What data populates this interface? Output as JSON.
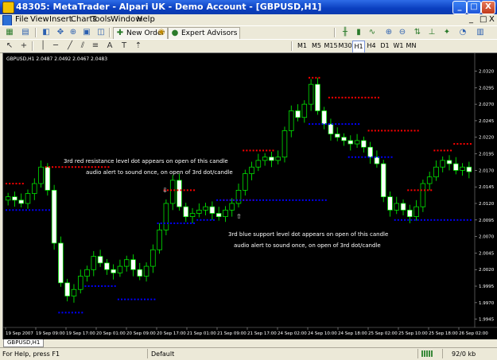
{
  "window": {
    "title": "48305: MetaTrader - Alpari UK - Demo Account - [GBPUSD,H1]",
    "min_label": "_",
    "max_label": "□",
    "close_label": "X"
  },
  "menu": [
    "File",
    "View",
    "Insert",
    "Charts",
    "Tools",
    "Window",
    "Help"
  ],
  "mdi_controls": [
    "_",
    "□",
    "X"
  ],
  "toolbar": {
    "new_order_label": "New Order",
    "expert_advisors_label": "Expert Advisors"
  },
  "timeframes": [
    "M1",
    "M5",
    "M15",
    "M30",
    "H1",
    "H4",
    "D1",
    "W1",
    "MN"
  ],
  "active_timeframe": "H1",
  "chart": {
    "header": "GBPUSD,H1  2.0487 2.0492 2.0467 2.0483",
    "annotations": {
      "red_line1": "3rd red resistance level dot appears on open of this candle",
      "red_line2": "audio alert to sound once, on open of 3rd dot/candle",
      "blue_line1": "3rd blue support level dot appears on open of this candle",
      "blue_line2": "audio alert to sound once, on open of 3rd dot/candle"
    },
    "colors": {
      "background": "#000000",
      "candle_outline": "#00FF00",
      "resistance_dots": "#FF0000",
      "support_dots": "#0000FF",
      "axis_text": "#FFFFFF"
    }
  },
  "chart_data": {
    "type": "candlestick",
    "symbol": "GBPUSD",
    "timeframe": "H1",
    "ylim": [
      1.9935,
      2.0335
    ],
    "y_ticks": [
      "2.0320",
      "2.0295",
      "2.0270",
      "2.0245",
      "2.0220",
      "2.0195",
      "2.0170",
      "2.0145",
      "2.0120",
      "2.0095",
      "2.0070",
      "2.0045",
      "2.0020",
      "1.9995",
      "1.9970",
      "1.9945"
    ],
    "x_ticks": [
      "19 Sep 2007",
      "19 Sep 09:00",
      "19 Sep 17:00",
      "20 Sep 01:00",
      "20 Sep 09:00",
      "20 Sep 17:00",
      "21 Sep 01:00",
      "21 Sep 09:00",
      "21 Sep 17:00",
      "24 Sep 02:00",
      "24 Sep 10:00",
      "24 Sep 18:00",
      "25 Sep 02:00",
      "25 Sep 10:00",
      "25 Sep 18:00",
      "26 Sep 02:00"
    ],
    "close_series": [
      2.013,
      2.0125,
      2.012,
      2.0135,
      2.015,
      2.0175,
      2.014,
      2.006,
      2.0,
      1.998,
      1.999,
      2.001,
      2.002,
      2.004,
      2.003,
      2.002,
      2.0015,
      2.0025,
      2.0035,
      2.002,
      2.001,
      2.0025,
      2.005,
      2.008,
      2.012,
      2.0155,
      2.0115,
      2.01,
      2.0105,
      2.011,
      2.0115,
      2.0105,
      2.01,
      2.011,
      2.012,
      2.014,
      2.0165,
      2.0175,
      2.0185,
      2.019,
      2.0185,
      2.019,
      2.023,
      2.026,
      2.025,
      2.027,
      2.03,
      2.026,
      2.024,
      2.0225,
      2.022,
      2.0215,
      2.021,
      2.0215,
      2.0205,
      2.019,
      2.018,
      2.013,
      2.011,
      2.012,
      2.011,
      2.01,
      2.0115,
      2.015,
      2.016,
      2.0175,
      2.0185,
      2.018,
      2.017,
      2.0175,
      2.0168
    ],
    "resistance_levels": [
      {
        "from": 0,
        "to": 2,
        "value": 2.015
      },
      {
        "from": 6,
        "to": 15,
        "value": 2.0175
      },
      {
        "from": 24,
        "to": 28,
        "value": 2.014
      },
      {
        "from": 33,
        "to": 37,
        "value": 2.0125
      },
      {
        "from": 36,
        "to": 40,
        "value": 2.02
      },
      {
        "from": 46,
        "to": 47,
        "value": 2.031
      },
      {
        "from": 49,
        "to": 56,
        "value": 2.028
      },
      {
        "from": 55,
        "to": 62,
        "value": 2.023
      },
      {
        "from": 61,
        "to": 64,
        "value": 2.014
      },
      {
        "from": 65,
        "to": 67,
        "value": 2.02
      },
      {
        "from": 68,
        "to": 70,
        "value": 2.021
      }
    ],
    "support_levels": [
      {
        "from": 0,
        "to": 6,
        "value": 2.011
      },
      {
        "from": 8,
        "to": 11,
        "value": 1.9955
      },
      {
        "from": 12,
        "to": 16,
        "value": 1.9995
      },
      {
        "from": 17,
        "to": 22,
        "value": 1.9975
      },
      {
        "from": 23,
        "to": 28,
        "value": 2.009
      },
      {
        "from": 29,
        "to": 31,
        "value": 2.0095
      },
      {
        "from": 32,
        "to": 48,
        "value": 2.0125
      },
      {
        "from": 46,
        "to": 53,
        "value": 2.024
      },
      {
        "from": 52,
        "to": 58,
        "value": 2.019
      },
      {
        "from": 59,
        "to": 70,
        "value": 2.0095
      }
    ]
  },
  "tabs": [
    "GBPUSD,H1"
  ],
  "status": {
    "help": "For Help, press F1",
    "profile": "Default",
    "traffic": "92/0 kb"
  }
}
